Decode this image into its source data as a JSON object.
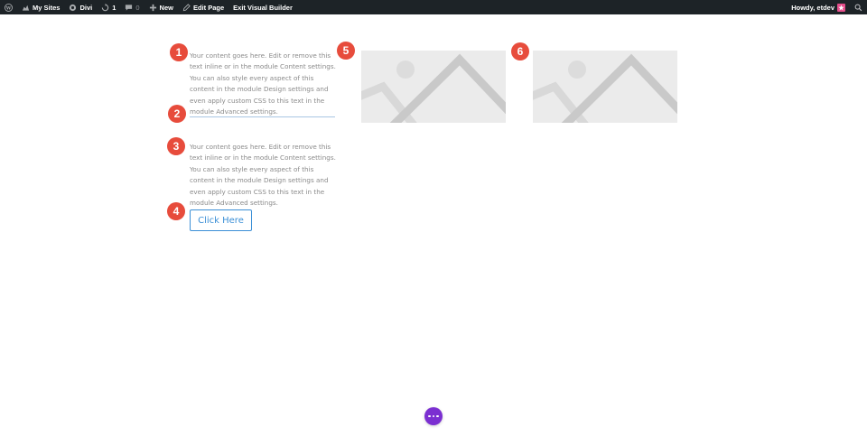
{
  "adminbar": {
    "my_sites": "My Sites",
    "divi": "Divi",
    "updates_count": "1",
    "comments_count": "0",
    "new": "New",
    "edit_page": "Edit Page",
    "exit_builder": "Exit Visual Builder",
    "howdy": "Howdy, etdev"
  },
  "content": {
    "text1": "Your content goes here. Edit or remove this text inline or in the module Content settings. You can also style every aspect of this content in the module Design settings and even apply custom CSS to this text in the module Advanced settings.",
    "text2": "Your content goes here. Edit or remove this text inline or in the module Content settings. You can also style every aspect of this content in the module Design settings and even apply custom CSS to this text in the module Advanced settings.",
    "button_label": "Click Here"
  },
  "badges": [
    "1",
    "2",
    "3",
    "4",
    "5",
    "6"
  ],
  "colors": {
    "adminbar_bg": "#1d2327",
    "badge": "#e74c3c",
    "button_accent": "#3b8fd6",
    "fab": "#7b2fd1"
  },
  "icons": [
    "wordpress-icon",
    "my-sites-icon",
    "divi-icon",
    "updates-icon",
    "comments-icon",
    "plus-icon",
    "pencil-icon",
    "search-icon",
    "more-dots-icon",
    "image-placeholder-icon"
  ]
}
